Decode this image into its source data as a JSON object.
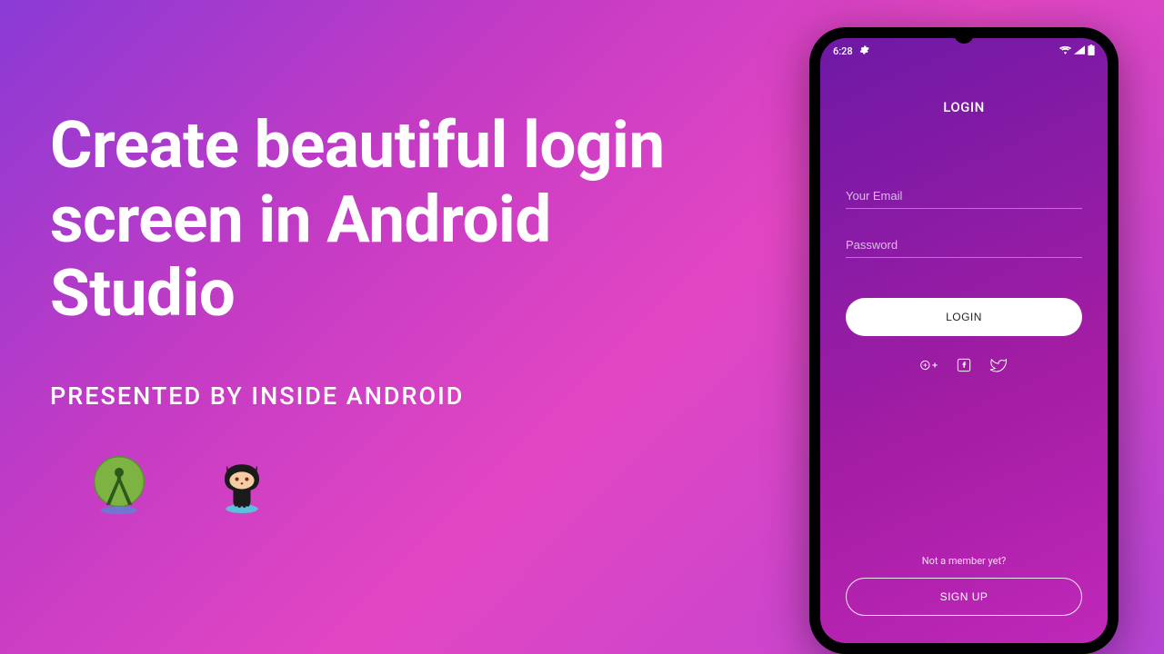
{
  "hero": {
    "headline": "Create beautiful login screen in Android Studio",
    "subhead": "PRESENTED BY INSIDE ANDROID"
  },
  "icons": {
    "android_studio": "android-studio-icon",
    "github": "github-octocat-icon"
  },
  "phone": {
    "statusbar": {
      "time": "6:28",
      "settings_icon": "gear-icon",
      "wifi_icon": "wifi-icon",
      "signal_icon": "signal-icon",
      "battery_icon": "battery-icon"
    },
    "login": {
      "title": "LOGIN",
      "email_placeholder": "Your Email",
      "password_placeholder": "Password",
      "login_button": "LOGIN",
      "social": {
        "google": "google-plus-icon",
        "facebook": "facebook-icon",
        "twitter": "twitter-icon"
      },
      "signup_prompt": "Not a member yet?",
      "signup_button": "SIGN UP"
    }
  },
  "colors": {
    "gradient_start": "#8a3ad5",
    "gradient_end": "#c43bc4",
    "phone_gradient_start": "#6e19a6",
    "phone_gradient_end": "#c028b9"
  }
}
